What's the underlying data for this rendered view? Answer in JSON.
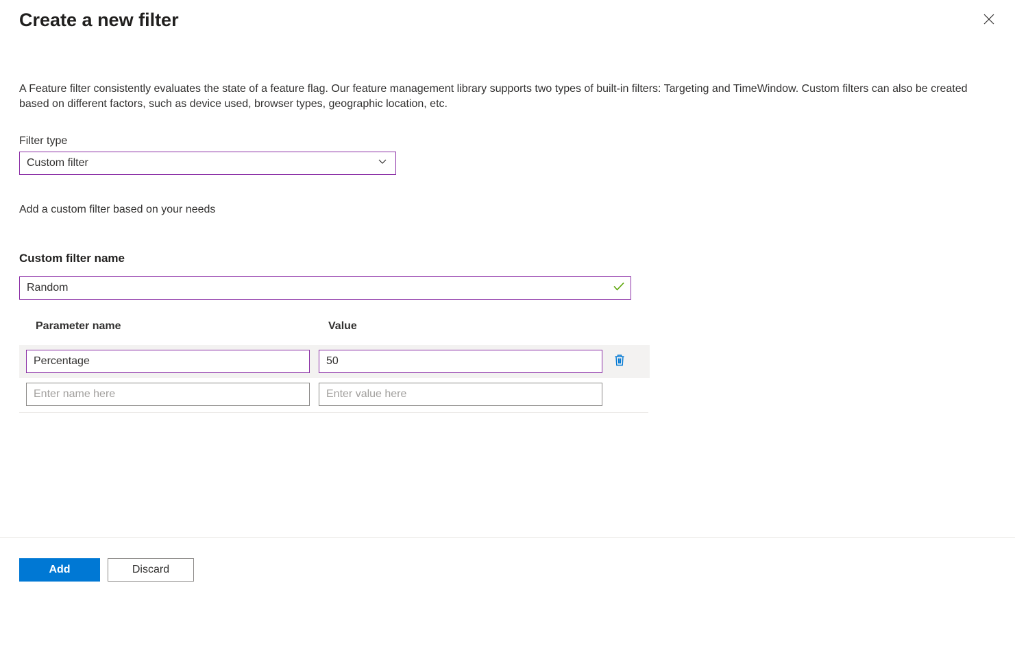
{
  "header": {
    "title": "Create a new filter"
  },
  "description": "A Feature filter consistently evaluates the state of a feature flag. Our feature management library supports two types of built-in filters: Targeting and TimeWindow. Custom filters can also be created based on different factors, such as device used, browser types, geographic location, etc.",
  "filterType": {
    "label": "Filter type",
    "value": "Custom filter"
  },
  "helperText": "Add a custom filter based on your needs",
  "customFilterName": {
    "label": "Custom filter name",
    "value": "Random"
  },
  "parameters": {
    "headers": {
      "name": "Parameter name",
      "value": "Value"
    },
    "rows": [
      {
        "name": "Percentage",
        "value": "50"
      }
    ],
    "placeholders": {
      "name": "Enter name here",
      "value": "Enter value here"
    }
  },
  "footer": {
    "add": "Add",
    "discard": "Discard"
  }
}
